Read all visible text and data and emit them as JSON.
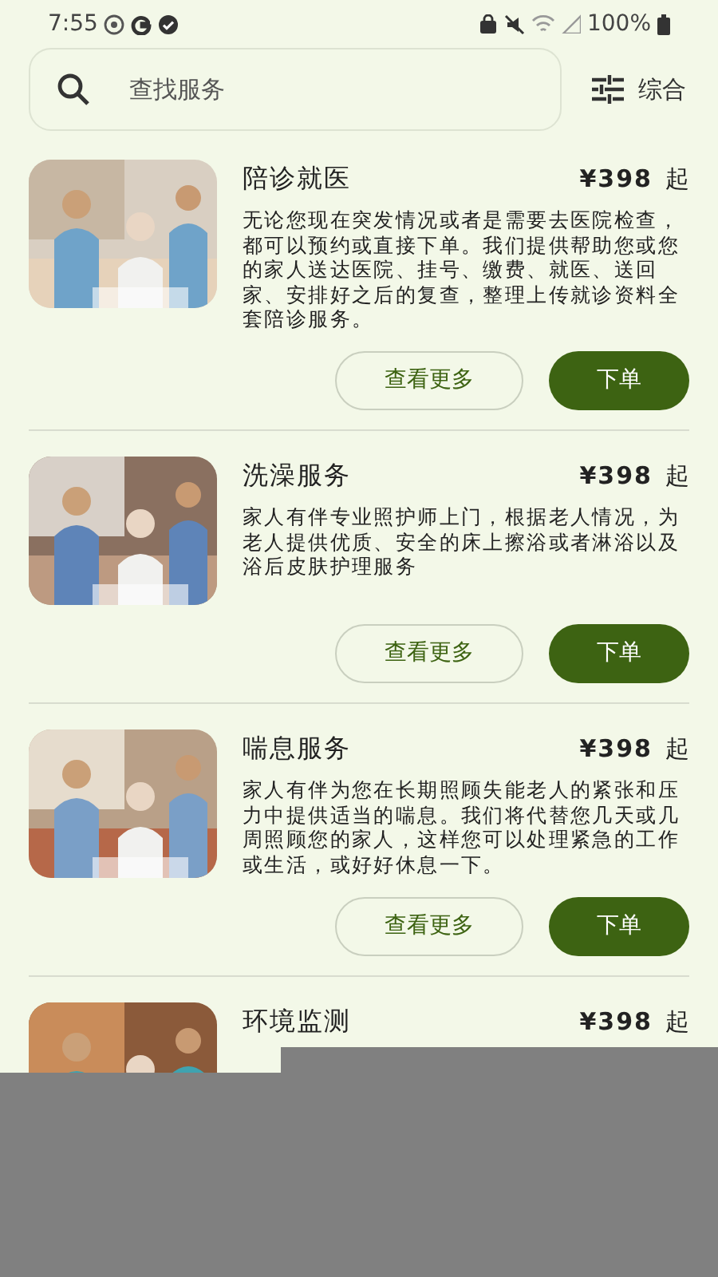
{
  "status_bar": {
    "time": "7:55",
    "battery": "100%"
  },
  "search": {
    "placeholder": "查找服务"
  },
  "sort": {
    "label": "综合"
  },
  "services": [
    {
      "title": "陪诊就医",
      "price": "¥398",
      "unit": "起",
      "description": "无论您现在突发情况或者是需要去医院检查，都可以预约或直接下单。我们提供帮助您或您的家人送达医院、挂号、缴费、就医、送回家、安排好之后的复查，整理上传就诊资料全套陪诊服务。",
      "more_button": "查看更多",
      "order_button": "下单"
    },
    {
      "title": "洗澡服务",
      "price": "¥398",
      "unit": "起",
      "description": "家人有伴专业照护师上门，根据老人情况，为老人提供优质、安全的床上擦浴或者淋浴以及浴后皮肤护理服务",
      "more_button": "查看更多",
      "order_button": "下单"
    },
    {
      "title": "喘息服务",
      "price": "¥398",
      "unit": "起",
      "description": "家人有伴为您在长期照顾失能老人的紧张和压力中提供适当的喘息。我们将代替您几天或几周照顾您的家人，这样您可以处理紧急的工作或生活，或好好休息一下。",
      "more_button": "查看更多",
      "order_button": "下单"
    },
    {
      "title": "环境监测",
      "price": "¥398",
      "unit": "起"
    }
  ]
}
